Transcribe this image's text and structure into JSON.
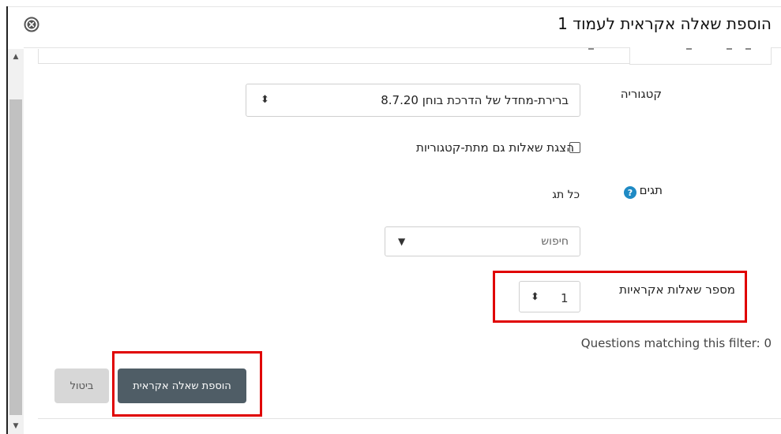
{
  "dialog": {
    "title": "הוספת שאלה אקראית לעמוד 1",
    "close_icon": "close-circle-icon"
  },
  "form": {
    "category_label": "קטגוריה",
    "category_value": "ברירת-מחדל של הדרכת בוחן 8.7.20",
    "subcategories_checkbox": {
      "label": "הצגת שאלות גם מתת-קטגוריות",
      "checked": false
    },
    "tags_label": "תגים",
    "tags_help_icon": "help-question-icon",
    "tags_value": "כל תג",
    "tags_search_placeholder": "חיפוש",
    "random_count_label": "מספר שאלות אקראיות",
    "random_count_value": "1",
    "matching_text": "Questions matching this filter: 0"
  },
  "buttons": {
    "add": "הוספת שאלה אקראית",
    "cancel": "ביטול"
  },
  "colors": {
    "highlight": "#e00000",
    "primary_button": "#4f5d66",
    "secondary_button": "#d7d7d7",
    "help_icon": "#1f8ac4"
  }
}
